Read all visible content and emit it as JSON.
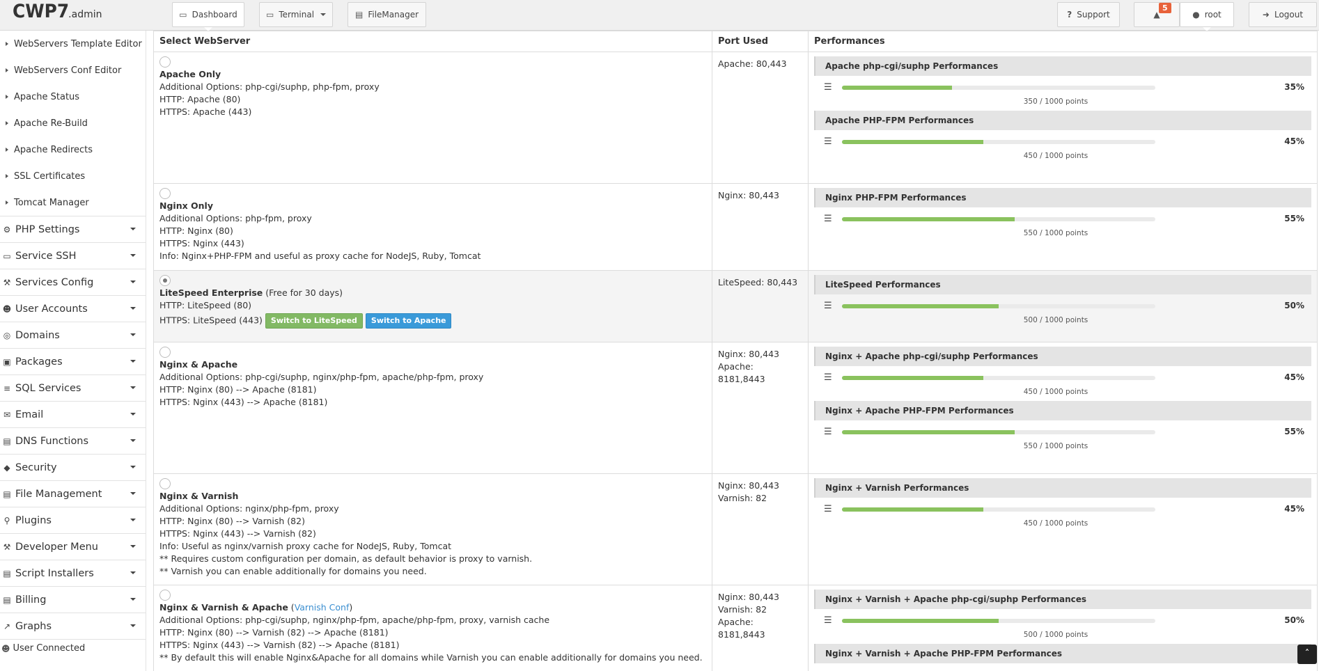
{
  "header": {
    "logo_main": "CWP7",
    "logo_sub": ".admin",
    "buttons": [
      {
        "label": "Dashboard",
        "icon": "monitor-icon"
      },
      {
        "label": "Terminal",
        "icon": "monitor-icon"
      },
      {
        "label": "FileManager",
        "icon": "folder-icon"
      }
    ],
    "support_label": "Support",
    "notification_count": "5",
    "user_label": "root",
    "logout_label": "Logout"
  },
  "sidebar": {
    "subitems": [
      "WebServers Template Editor",
      "WebServers Conf Editor",
      "Apache Status",
      "Apache Re-Build",
      "Apache Redirects",
      "SSL Certificates",
      "Tomcat Manager"
    ],
    "menu": [
      {
        "label": "PHP Settings",
        "icon": "gear-icon"
      },
      {
        "label": "Service SSH",
        "icon": "monitor-icon"
      },
      {
        "label": "Services Config",
        "icon": "wrench-icon"
      },
      {
        "label": "User Accounts",
        "icon": "user-icon"
      },
      {
        "label": "Domains",
        "icon": "globe-icon"
      },
      {
        "label": "Packages",
        "icon": "cube-icon"
      },
      {
        "label": "SQL Services",
        "icon": "database-icon"
      },
      {
        "label": "Email",
        "icon": "envelope-icon"
      },
      {
        "label": "DNS Functions",
        "icon": "dns-icon"
      },
      {
        "label": "Security",
        "icon": "shield-icon"
      },
      {
        "label": "File Management",
        "icon": "folder-icon"
      },
      {
        "label": "Plugins",
        "icon": "plug-icon"
      },
      {
        "label": "Developer Menu",
        "icon": "hammer-icon"
      },
      {
        "label": "Script Installers",
        "icon": "installer-icon"
      },
      {
        "label": "Billing",
        "icon": "billing-icon"
      },
      {
        "label": "Graphs",
        "icon": "chart-icon"
      }
    ],
    "user_connected": "User Connected"
  },
  "table": {
    "headers": [
      "Select WebServer",
      "Port Used",
      "Performances"
    ],
    "rows": [
      {
        "name": "Apache Only",
        "lines": [
          "Additional Options: php-cgi/suphp, php-fpm, proxy",
          "HTTP: Apache (80)",
          "HTTPS: Apache (443)"
        ],
        "ports": [
          "Apache: 80,443"
        ],
        "perf": [
          {
            "title": "Apache php-cgi/suphp Performances",
            "pct": "35%",
            "points": "350 / 1000 points",
            "value": 0.35
          },
          {
            "title": "Apache PHP-FPM Performances",
            "pct": "45%",
            "points": "450 / 1000 points",
            "value": 0.45
          }
        ]
      },
      {
        "name": "Nginx Only",
        "lines": [
          "Additional Options: php-fpm, proxy",
          "HTTP: Nginx (80)",
          "HTTPS: Nginx (443)",
          "Info: Nginx+PHP-FPM and useful as proxy cache for NodeJS, Ruby, Tomcat"
        ],
        "ports": [
          "Nginx: 80,443"
        ],
        "perf": [
          {
            "title": "Nginx PHP-FPM Performances",
            "pct": "55%",
            "points": "550 / 1000 points",
            "value": 0.55
          }
        ]
      },
      {
        "name": "LiteSpeed Enterprise",
        "name_suffix": " (Free for 30 days)",
        "lines": [
          "HTTP: LiteSpeed (80)"
        ],
        "https_line": "HTTPS: LiteSpeed (443)",
        "btn_litespeed": "Switch to LiteSpeed",
        "btn_apache": "Switch to Apache",
        "ports": [
          "LiteSpeed: 80,443"
        ],
        "perf": [
          {
            "title": "LiteSpeed Performances",
            "pct": "50%",
            "points": "500 / 1000 points",
            "value": 0.5
          }
        ]
      },
      {
        "name": "Nginx & Apache",
        "lines": [
          "Additional Options: php-cgi/suphp, nginx/php-fpm, apache/php-fpm, proxy",
          "HTTP: Nginx (80) --> Apache (8181)",
          "HTTPS: Nginx (443) --> Apache (8181)"
        ],
        "ports": [
          "Nginx: 80,443",
          "Apache: 8181,8443"
        ],
        "perf": [
          {
            "title": "Nginx + Apache php-cgi/suphp Performances",
            "pct": "45%",
            "points": "450 / 1000 points",
            "value": 0.45
          },
          {
            "title": "Nginx + Apache PHP-FPM Performances",
            "pct": "55%",
            "points": "550 / 1000 points",
            "value": 0.55
          }
        ]
      },
      {
        "name": "Nginx & Varnish",
        "lines": [
          "Additional Options: nginx/php-fpm, proxy",
          "HTTP: Nginx (80) --> Varnish (82)",
          "HTTPS: Nginx (443) --> Varnish (82)",
          "Info: Useful as nginx/varnish proxy cache for NodeJS, Ruby, Tomcat",
          "** Requires custom configuration per domain, as default behavior is proxy to varnish.",
          "** Varnish you can enable additionally for domains you need."
        ],
        "ports": [
          "Nginx: 80,443",
          "Varnish: 82"
        ],
        "perf": [
          {
            "title": "Nginx + Varnish Performances",
            "pct": "45%",
            "points": "450 / 1000 points",
            "value": 0.45
          }
        ]
      },
      {
        "name": "Nginx & Varnish & Apache",
        "name_open": " (",
        "name_link": "Varnish Conf",
        "name_close": ")",
        "lines": [
          "Additional Options: php-cgi/suphp, nginx/php-fpm, apache/php-fpm, proxy, varnish cache",
          "HTTP: Nginx (80) --> Varnish (82) --> Apache (8181)",
          "HTTPS: Nginx (443) --> Varnish (82) --> Apache (8181)",
          "** By default this will enable Nginx&Apache for all domains while Varnish you can enable additionally for domains you need."
        ],
        "ports": [
          "Nginx: 80,443",
          "Varnish: 82",
          "Apache: 8181,8443"
        ],
        "perf": [
          {
            "title": "Nginx + Varnish + Apache php-cgi/suphp Performances",
            "pct": "50%",
            "points": "500 / 1000 points",
            "value": 0.5
          },
          {
            "title": "Nginx + Varnish + Apache PHP-FPM Performances",
            "pct": "",
            "points": "",
            "value": null
          }
        ]
      }
    ]
  },
  "colors": {
    "bar_fill": "#8ac25e",
    "badge": "#e8623a",
    "btn_green": "#82b964",
    "btn_blue": "#3a9ad9"
  }
}
